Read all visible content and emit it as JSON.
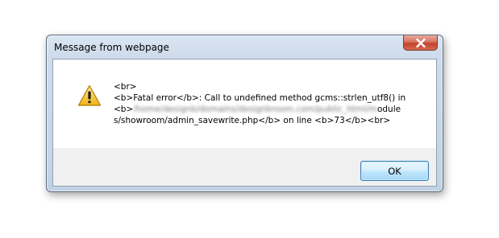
{
  "dialog": {
    "title": "Message from webpage",
    "message_lines": [
      "<br>",
      "<b>Fatal error</b>:  Call to undefined method gcms::strlen_utf8() in",
      "s/showroom/admin_savewrite.php</b> on line <b>73</b><br>"
    ],
    "line3_prefix": "<b>",
    "line3_blurred": "/home/designb/domains/designbroom.com/public_html/m",
    "line3_suffix": "odule",
    "ok_label": "OK",
    "icon": "warning-icon",
    "close_icon": "close-icon"
  },
  "colors": {
    "close_button": "#c94b34",
    "ok_border": "#3c7fb1",
    "warning_yellow": "#f3c623"
  }
}
